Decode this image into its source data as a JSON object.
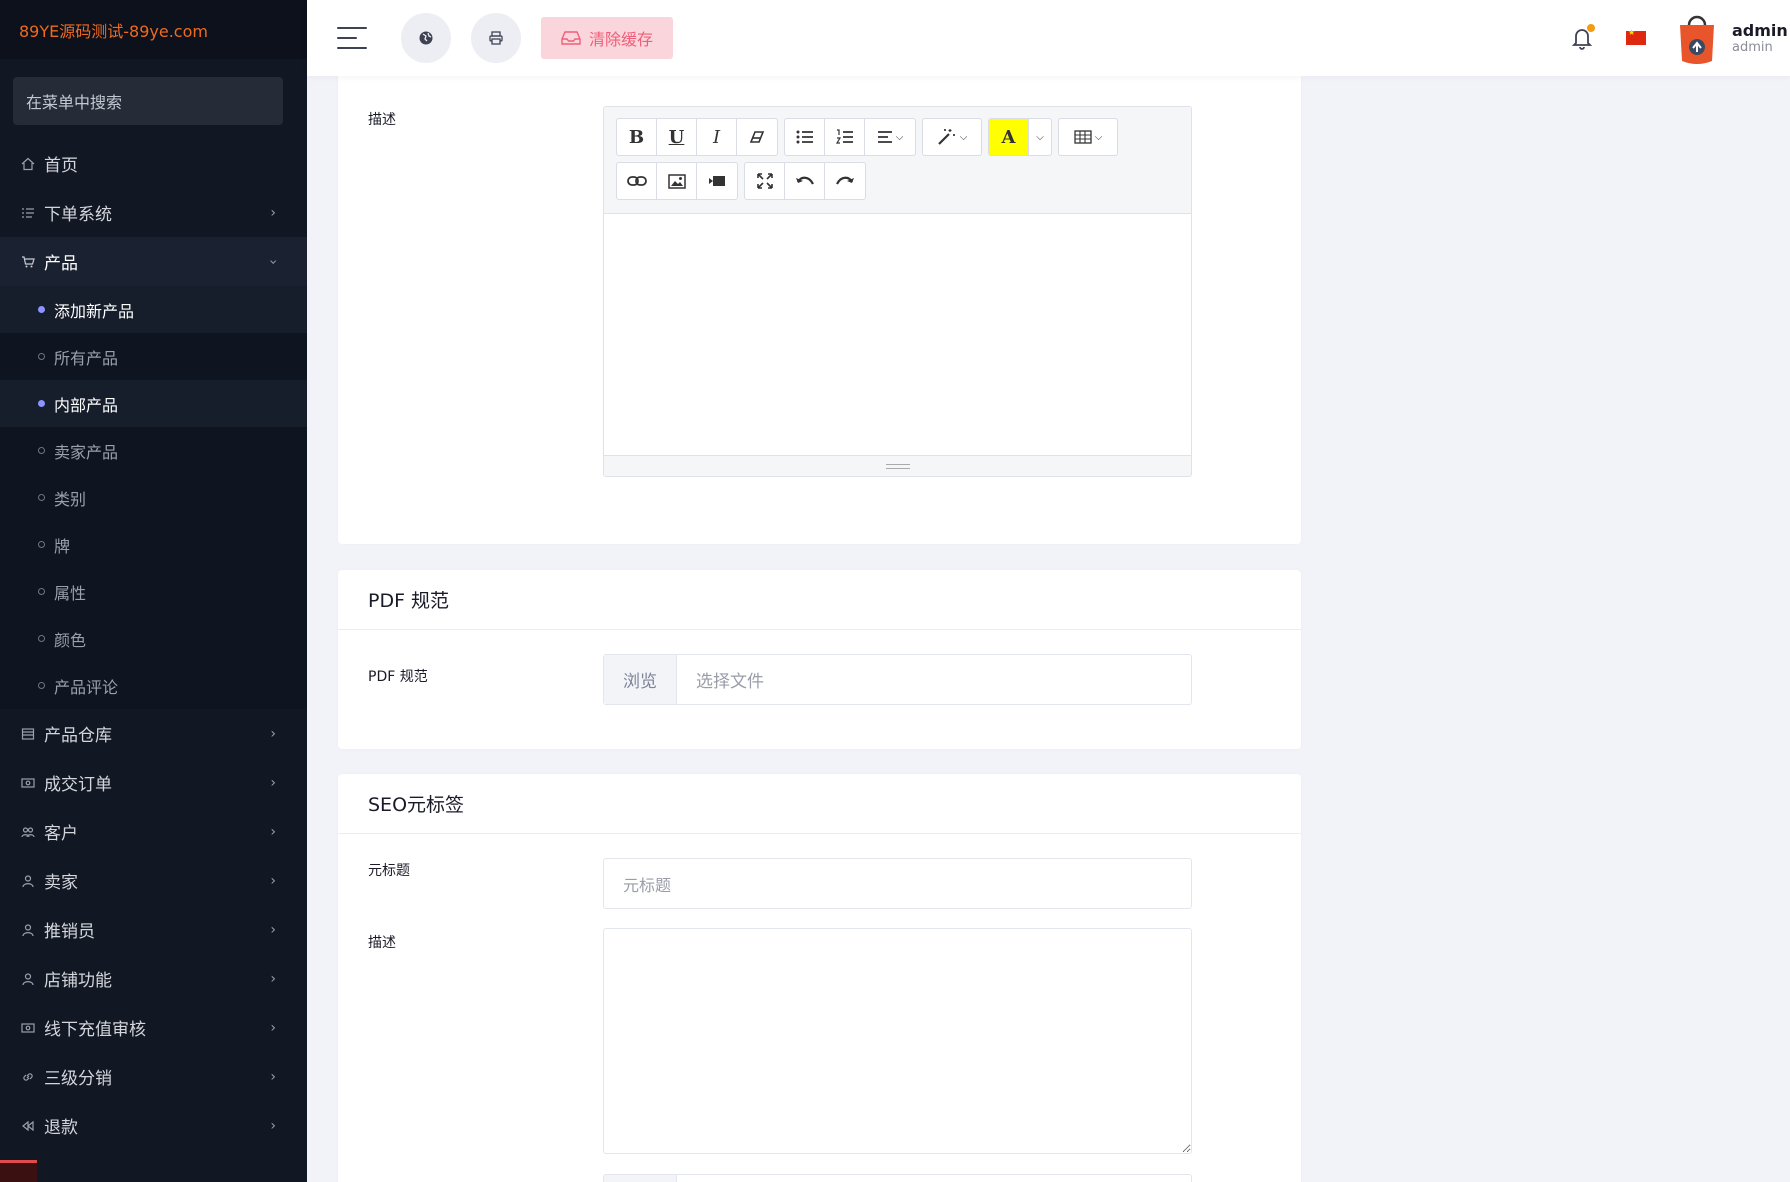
{
  "brand": {
    "title": "89YE源码测试-89ye.com"
  },
  "sidebar": {
    "search_placeholder": "在菜单中搜索",
    "items": [
      {
        "label": "首页",
        "icon": "home-icon"
      },
      {
        "label": "下单系统",
        "icon": "list-icon"
      },
      {
        "label": "产品",
        "icon": "cart-icon"
      }
    ],
    "product_sub": [
      {
        "label": "添加新产品"
      },
      {
        "label": "所有产品"
      },
      {
        "label": "内部产品"
      },
      {
        "label": "卖家产品"
      },
      {
        "label": "类别"
      },
      {
        "label": "牌"
      },
      {
        "label": "属性"
      },
      {
        "label": "颜色"
      },
      {
        "label": "产品评论"
      }
    ],
    "items_after": [
      {
        "label": "产品仓库",
        "icon": "warehouse-icon"
      },
      {
        "label": "成交订单",
        "icon": "money-icon"
      },
      {
        "label": "客户",
        "icon": "users-icon"
      },
      {
        "label": "卖家",
        "icon": "user-icon"
      },
      {
        "label": "推销员",
        "icon": "user-icon"
      },
      {
        "label": "店铺功能",
        "icon": "user-icon"
      },
      {
        "label": "线下充值审核",
        "icon": "money-icon"
      },
      {
        "label": "三级分销",
        "icon": "link-icon"
      },
      {
        "label": "退款",
        "icon": "backward-icon"
      }
    ]
  },
  "header": {
    "clear_cache_label": "清除缓存",
    "user_name": "admin",
    "user_role": "admin"
  },
  "description_card": {
    "label": "描述"
  },
  "pdf_card": {
    "title": "PDF 规范",
    "label": "PDF 规范",
    "browse_label": "浏览",
    "file_placeholder": "选择文件"
  },
  "seo_card": {
    "title": "SEO元标签",
    "meta_title_label": "元标题",
    "meta_title_placeholder": "元标题",
    "desc_label": "描述"
  }
}
